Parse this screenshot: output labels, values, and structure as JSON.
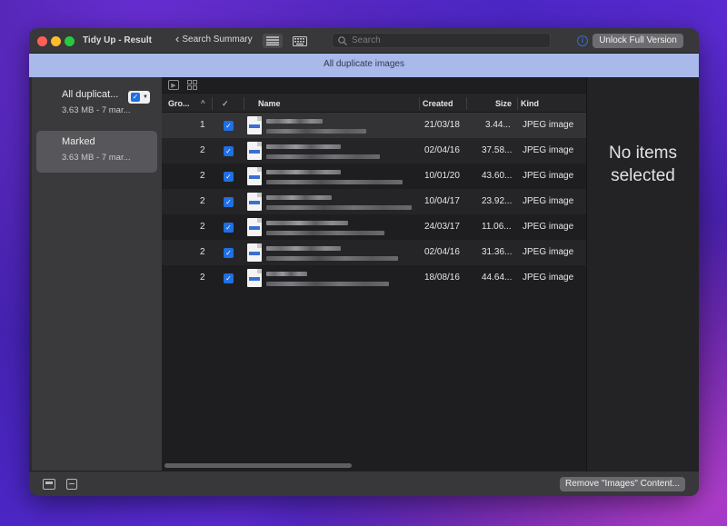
{
  "window": {
    "title": "Tidy Up - Result"
  },
  "toolbar": {
    "back_label": "Search Summary",
    "search_placeholder": "Search",
    "unlock_label": "Unlock Full Version"
  },
  "banner": {
    "text": "All duplicate images"
  },
  "sidebar": {
    "items": [
      {
        "title": "All duplicat...",
        "subtitle": "3.63 MB - 7 mar...",
        "checked": true
      },
      {
        "title": "Marked",
        "subtitle": "3.63 MB - 7 mar..."
      }
    ]
  },
  "table": {
    "headers": {
      "group": "Gro...",
      "checked": "✓",
      "name": "Name",
      "created": "Created",
      "size": "Size",
      "kind": "Kind"
    },
    "rows": [
      {
        "group": "1",
        "checked": true,
        "created": "21/03/18",
        "size": "3.44...",
        "kind": "JPEG image"
      },
      {
        "group": "2",
        "checked": true,
        "created": "02/04/16",
        "size": "37.58...",
        "kind": "JPEG image"
      },
      {
        "group": "2",
        "checked": true,
        "created": "10/01/20",
        "size": "43.60...",
        "kind": "JPEG image"
      },
      {
        "group": "2",
        "checked": true,
        "created": "10/04/17",
        "size": "23.92...",
        "kind": "JPEG image"
      },
      {
        "group": "2",
        "checked": true,
        "created": "24/03/17",
        "size": "11.06...",
        "kind": "JPEG image"
      },
      {
        "group": "2",
        "checked": true,
        "created": "02/04/16",
        "size": "31.36...",
        "kind": "JPEG image"
      },
      {
        "group": "2",
        "checked": true,
        "created": "18/08/16",
        "size": "44.64...",
        "kind": "JPEG image"
      }
    ]
  },
  "detail": {
    "empty_line1": "No items",
    "empty_line2": "selected"
  },
  "bottom": {
    "remove_label": "Remove \"Images\" Content..."
  },
  "colors": {
    "accent": "#1f6fe5",
    "banner": "#a9b9ea"
  }
}
